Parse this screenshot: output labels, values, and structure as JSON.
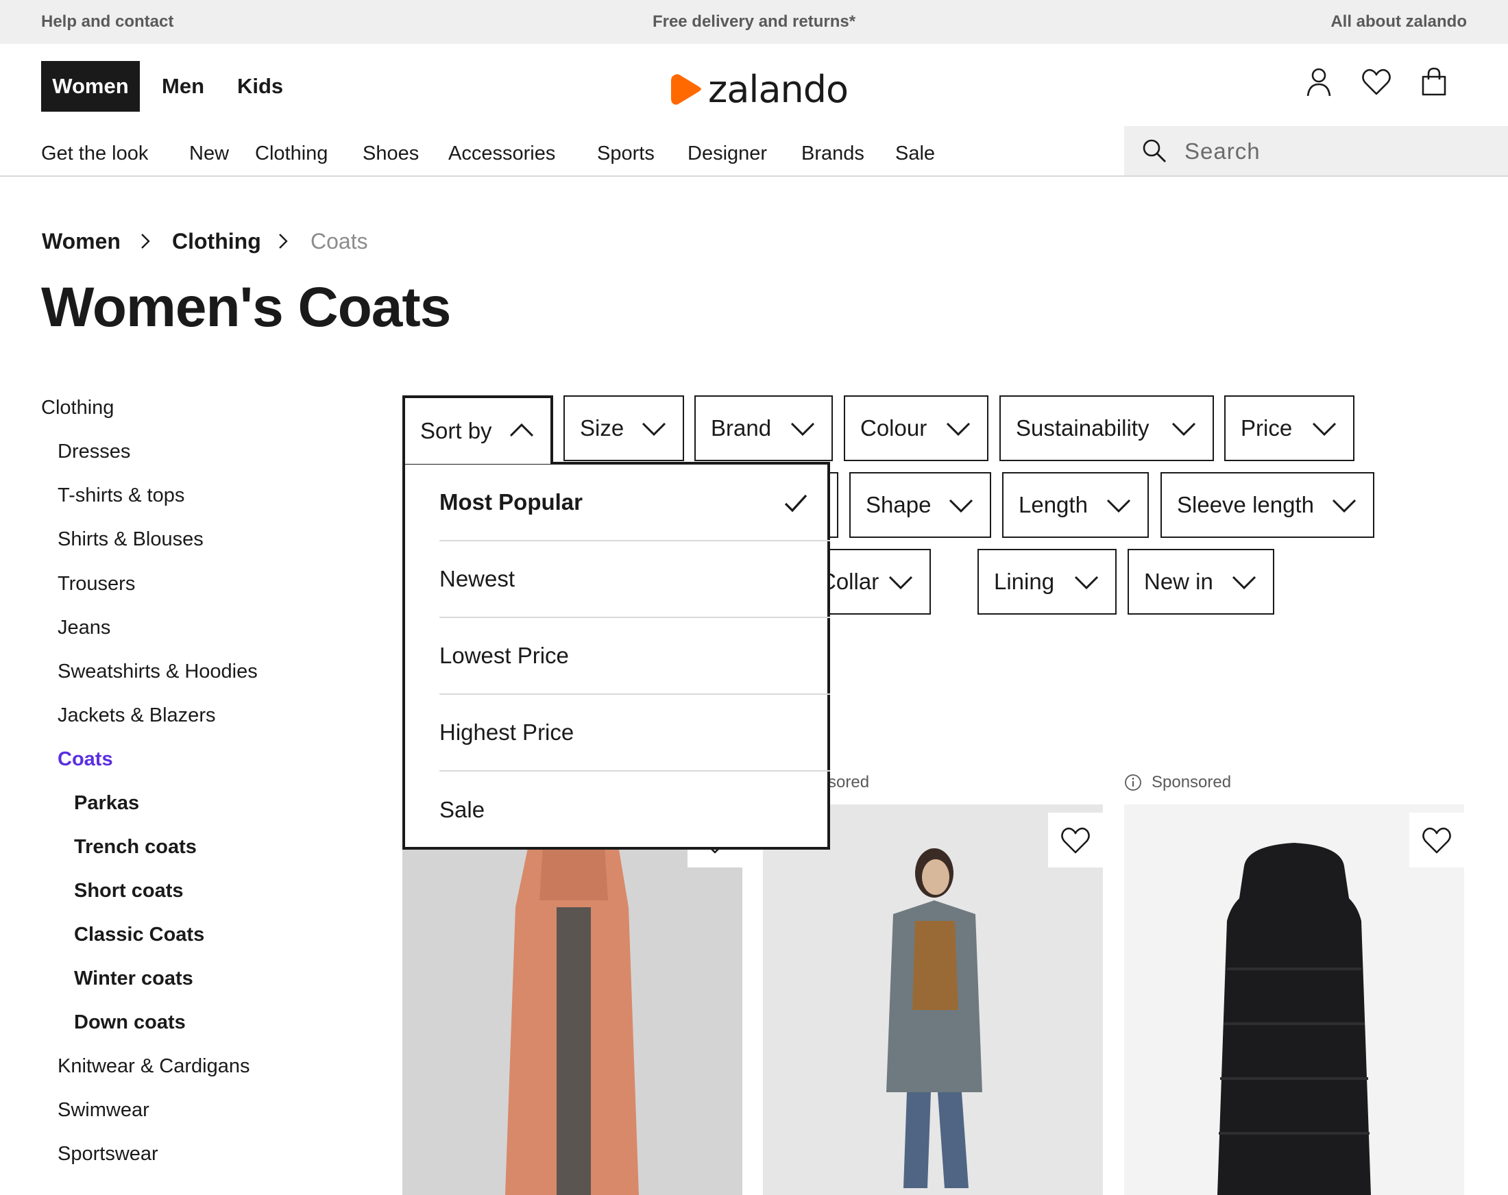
{
  "topbar": {
    "help": "Help and contact",
    "delivery": "Free delivery and returns*",
    "about": "All about zalando"
  },
  "header": {
    "gender_tabs": [
      "Women",
      "Men",
      "Kids"
    ],
    "active_gender": "Women",
    "logo_text": "zalando",
    "brand_color": "#ff6900",
    "icons": [
      "user-icon",
      "heart-icon",
      "bag-icon"
    ]
  },
  "nav": {
    "items": [
      "Get the look",
      "New",
      "Clothing",
      "Shoes",
      "Accessories",
      "Sports",
      "Designer",
      "Brands",
      "Sale"
    ],
    "search_placeholder": "Search"
  },
  "breadcrumb": [
    "Women",
    "Clothing",
    "Coats"
  ],
  "page_title": "Women's Coats",
  "sidebar": {
    "heading": "Clothing",
    "items": [
      "Dresses",
      "T-shirts & tops",
      "Shirts & Blouses",
      "Trousers",
      "Jeans",
      "Sweatshirts & Hoodies",
      "Jackets & Blazers",
      "Coats"
    ],
    "active": "Coats",
    "subitems": [
      "Parkas",
      "Trench coats",
      "Short coats",
      "Classic Coats",
      "Winter coats",
      "Down coats"
    ],
    "more_items": [
      "Knitwear & Cardigans",
      "Swimwear",
      "Sportswear"
    ],
    "accent_color": "#5a2fe0"
  },
  "filters": {
    "row1": [
      "Sort by",
      "Size",
      "Brand",
      "Colour",
      "Sustainability",
      "Price"
    ],
    "row2": [
      "Shape",
      "Length",
      "Sleeve length"
    ],
    "row3": [
      "Collar",
      "Lining",
      "New in"
    ]
  },
  "sort_dropdown": {
    "options": [
      "Most Popular",
      "Newest",
      "Lowest Price",
      "Highest Price",
      "Sale"
    ],
    "selected": "Most Popular"
  },
  "products": {
    "sponsored_label": "Sponsored",
    "partial_sponsored_label": "sored",
    "cards": [
      {
        "color": "#d8896a"
      },
      {
        "color": "#6f7a80"
      },
      {
        "color": "#1b1b1d"
      }
    ]
  }
}
